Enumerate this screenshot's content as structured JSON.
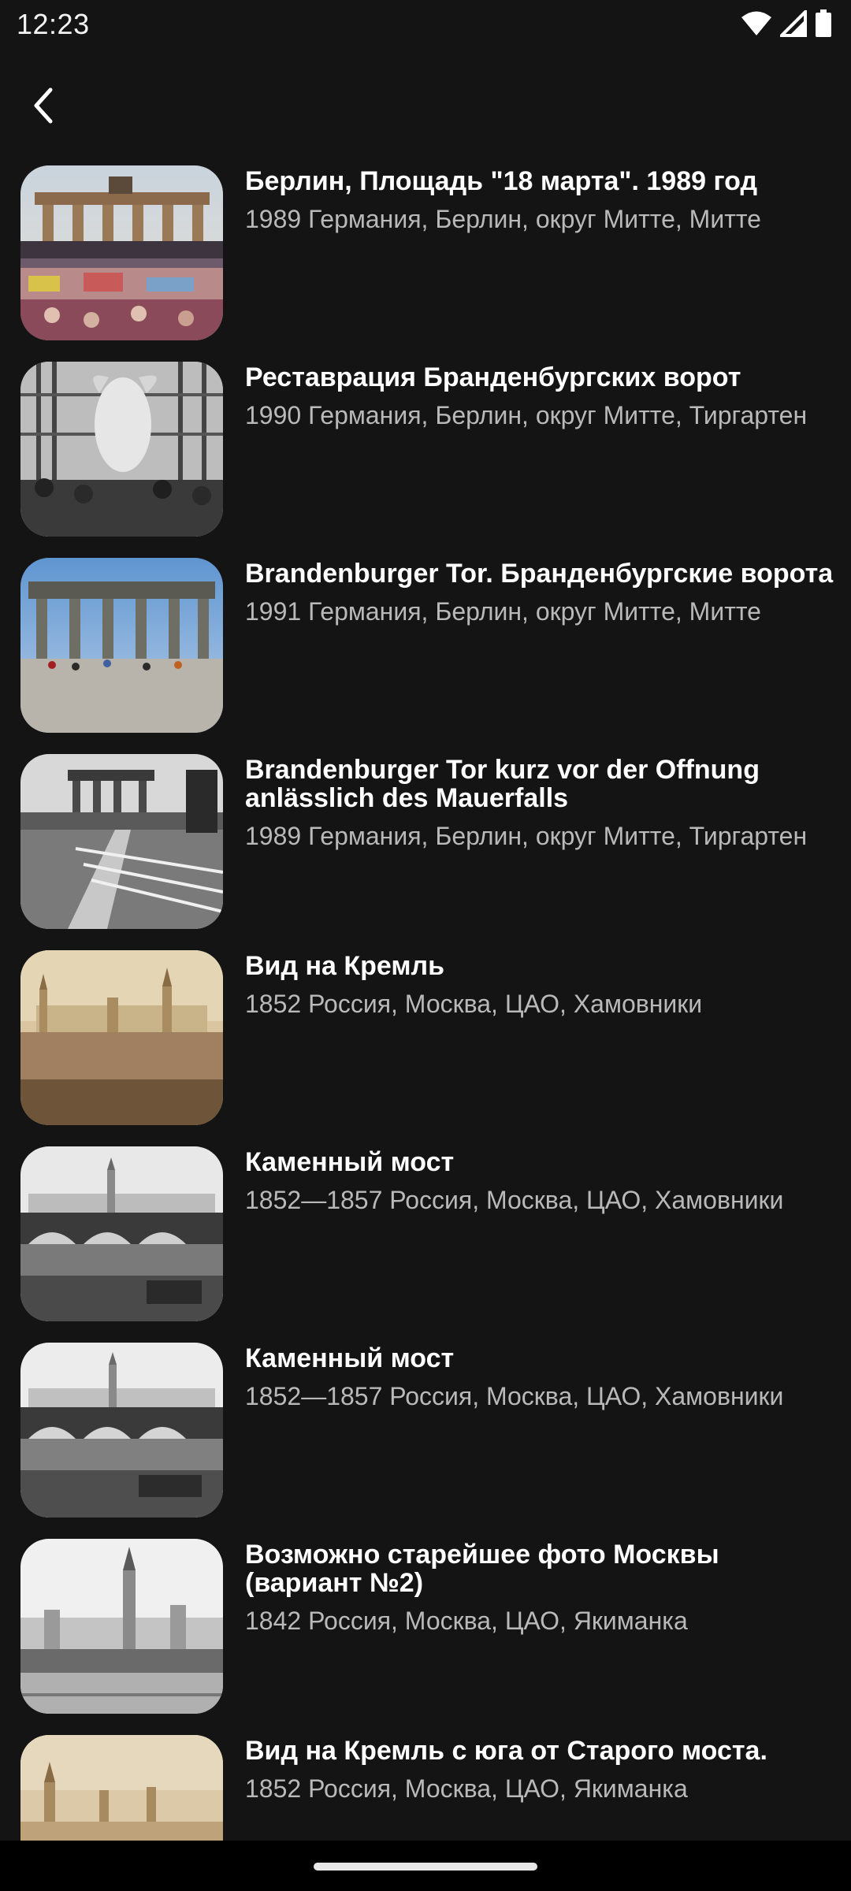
{
  "status_bar": {
    "time": "12:23",
    "icons": [
      "wifi-icon",
      "cellular-signal-icon",
      "battery-icon"
    ]
  },
  "app_bar": {
    "back_icon": "chevron-left-icon"
  },
  "items": [
    {
      "title": "Берлин, Площадь \"18 марта\". 1989 год",
      "subtitle": "1989 Германия, Берлин, округ Митте, Митте",
      "thumbnail": "brandenburg-gate-crowd-1989-photo"
    },
    {
      "title": "Реставрация Бранденбургских ворот",
      "subtitle": "1990 Германия, Берлин, округ Митте, Тиргартен",
      "thumbnail": "statue-restoration-bw-photo"
    },
    {
      "title": "Brandenburger Tor. Бранденбургские ворота",
      "subtitle": "1991 Германия, Берлин, округ Митте, Митте",
      "thumbnail": "brandenburg-gate-color-photo"
    },
    {
      "title": "Brandenburger Tor kurz vor der Offnung anlässlich des Mauerfalls",
      "subtitle": "1989 Германия, Берлин, округ Митте, Тиргартен",
      "thumbnail": "brandenburg-gate-barriers-bw-photo"
    },
    {
      "title": "Вид на Кремль",
      "subtitle": "1852 Россия, Москва, ЦАО, Хамовники",
      "thumbnail": "kremlin-sepia-photo"
    },
    {
      "title": "Каменный мост",
      "subtitle": "1852—1857 Россия, Москва, ЦАО, Хамовники",
      "thumbnail": "stone-bridge-bw-photo"
    },
    {
      "title": "Каменный мост",
      "subtitle": "1852—1857 Россия, Москва, ЦАО, Хамовники",
      "thumbnail": "stone-bridge-bw-photo"
    },
    {
      "title": "Возможно старейшее фото Москвы (вариант №2)",
      "subtitle": "1842 Россия, Москва, ЦАО, Якиманка",
      "thumbnail": "oldest-moscow-kremlin-bw-photo"
    },
    {
      "title": "Вид на Кремль с юга от Старого моста.",
      "subtitle": "1852 Россия, Москва, ЦАО, Якиманка",
      "thumbnail": "kremlin-from-south-sepia-photo"
    }
  ],
  "colors": {
    "background": "#141414",
    "title": "#ffffff",
    "subtitle": "#b9b9b9",
    "nav_bar": "#000000"
  }
}
